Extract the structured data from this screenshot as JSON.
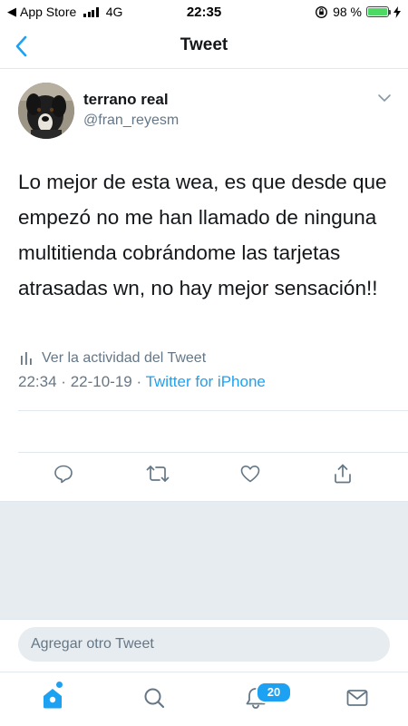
{
  "status_bar": {
    "carrier": "App Store",
    "network": "4G",
    "time": "22:35",
    "battery": "98 %",
    "battery_level": 0.98
  },
  "nav": {
    "title": "Tweet",
    "back_icon": "chevron-left-icon"
  },
  "tweet": {
    "author_name": "terrano real",
    "author_handle": "@fran_reyesm",
    "text": "Lo mejor de esta wea, es que desde que empezó no me han llamado de ninguna multitienda cobrándome las tarjetas atrasadas wn, no hay mejor sensación!!",
    "time": "22:34",
    "date": "22-10-19",
    "separator": "·",
    "source": "Twitter for iPhone",
    "activity_label": "Ver la actividad del Tweet"
  },
  "actions": [
    "reply-icon",
    "retweet-icon",
    "like-icon",
    "share-icon"
  ],
  "reply": {
    "placeholder": "Agregar otro Tweet"
  },
  "tabbar": {
    "tabs": [
      "home-icon",
      "search-icon",
      "notifications-icon",
      "messages-icon"
    ],
    "notifications_badge": "20"
  },
  "colors": {
    "accent": "#1da1f2",
    "secondary_text": "#657786",
    "divider": "#e1e8ed",
    "background_gray": "#e6ecf0"
  }
}
